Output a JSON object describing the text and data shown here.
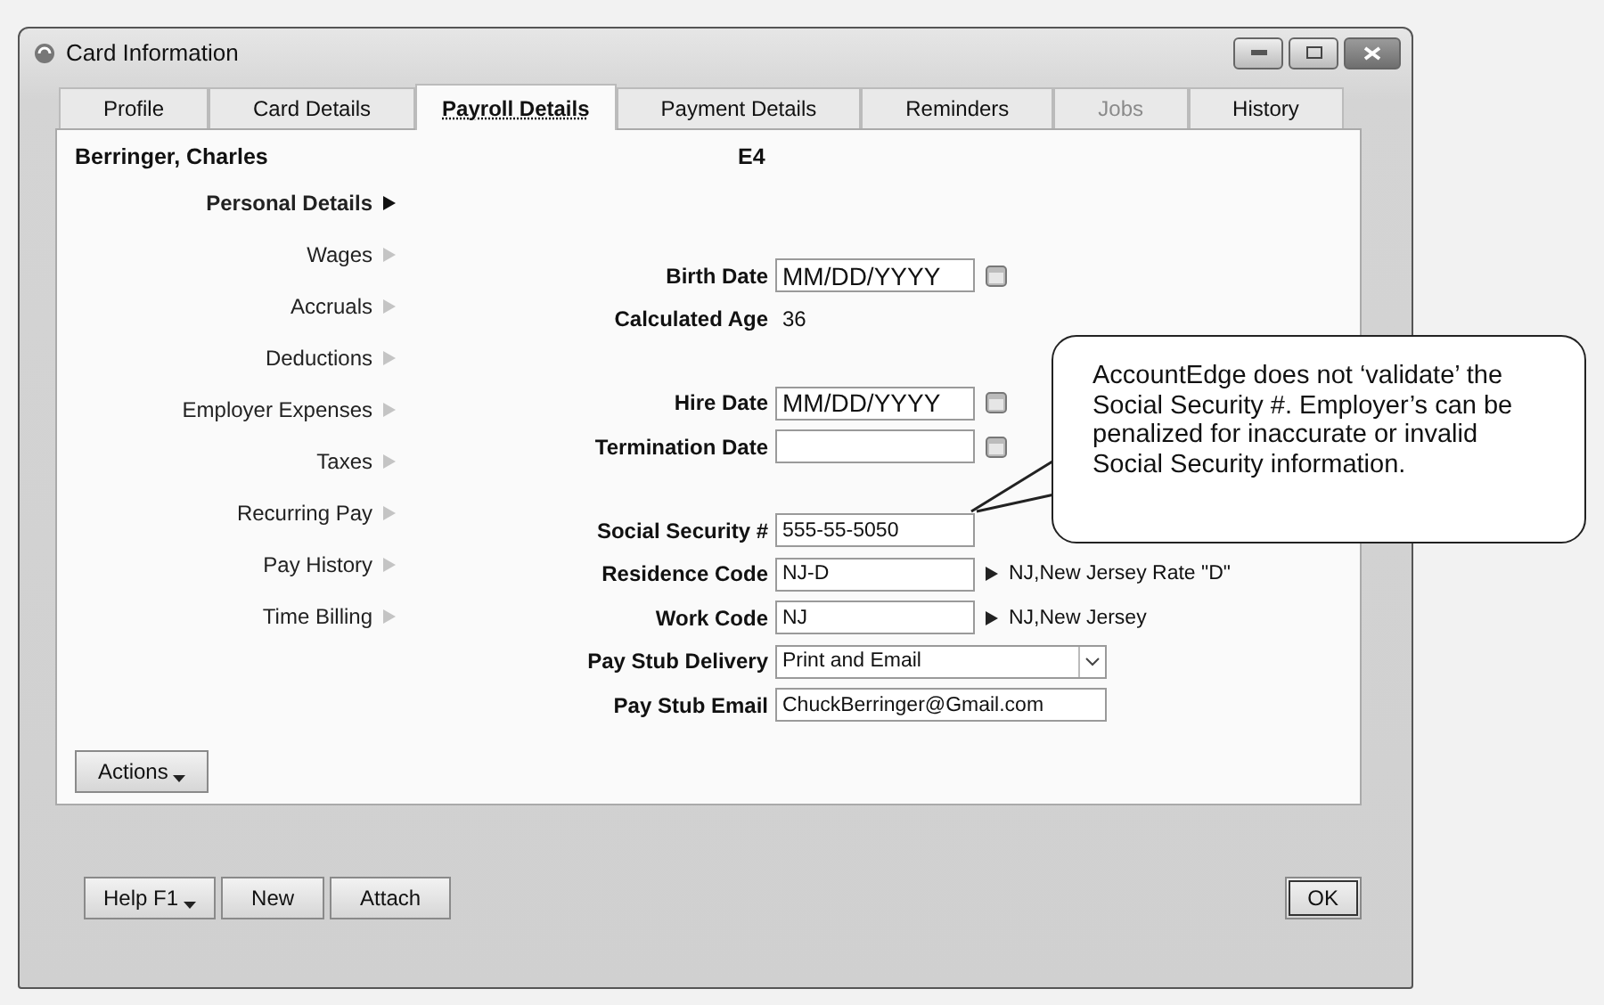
{
  "window": {
    "title": "Card Information"
  },
  "tabs": [
    {
      "label": "Profile",
      "selected": false,
      "disabled": false
    },
    {
      "label": "Card Details",
      "selected": false,
      "disabled": false
    },
    {
      "label": "Payroll Details",
      "selected": true,
      "disabled": false
    },
    {
      "label": "Payment Details",
      "selected": false,
      "disabled": false
    },
    {
      "label": "Reminders",
      "selected": false,
      "disabled": false
    },
    {
      "label": "Jobs",
      "selected": false,
      "disabled": true
    },
    {
      "label": "History",
      "selected": false,
      "disabled": false
    }
  ],
  "employee": {
    "name": "Berringer, Charles",
    "code": "E4"
  },
  "nav": [
    {
      "label": "Personal Details",
      "selected": true
    },
    {
      "label": "Wages",
      "selected": false
    },
    {
      "label": "Accruals",
      "selected": false
    },
    {
      "label": "Deductions",
      "selected": false
    },
    {
      "label": "Employer Expenses",
      "selected": false
    },
    {
      "label": "Taxes",
      "selected": false
    },
    {
      "label": "Recurring Pay",
      "selected": false
    },
    {
      "label": "Pay History",
      "selected": false
    },
    {
      "label": "Time Billing",
      "selected": false
    }
  ],
  "form_groups": [
    [
      {
        "kind": "date",
        "label": "Birth Date",
        "placeholder": "MM/DD/YYYY"
      },
      {
        "kind": "readout",
        "label": "Calculated Age",
        "value": "36"
      }
    ],
    [
      {
        "kind": "date",
        "label": "Hire Date",
        "placeholder": "MM/DD/YYYY"
      },
      {
        "kind": "date",
        "label": "Termination Date"
      }
    ],
    [
      {
        "kind": "text",
        "label": "Social Security #",
        "value": "555-55-5050"
      },
      {
        "kind": "lookup",
        "label": "Residence Code",
        "value": "NJ-D",
        "description": "NJ,New Jersey Rate \"D\""
      },
      {
        "kind": "lookup",
        "label": "Work Code",
        "value": "NJ",
        "description": "NJ,New Jersey"
      },
      {
        "kind": "select",
        "label": "Pay Stub Delivery",
        "value": "Print and Email"
      },
      {
        "kind": "email",
        "label": "Pay Stub Email",
        "value": "ChuckBerringer@Gmail.com"
      }
    ]
  ],
  "callout": {
    "text": "AccountEdge does not ‘validate’ the Social Security #. Employer’s can be penalized for inaccurate or invalid Social Security information."
  },
  "actions_button": "Actions",
  "footer": {
    "left_buttons": [
      {
        "label": "Help F1",
        "menu": true
      },
      {
        "label": "New",
        "menu": false
      },
      {
        "label": "Attach",
        "menu": false
      }
    ],
    "ok_button": "OK"
  }
}
